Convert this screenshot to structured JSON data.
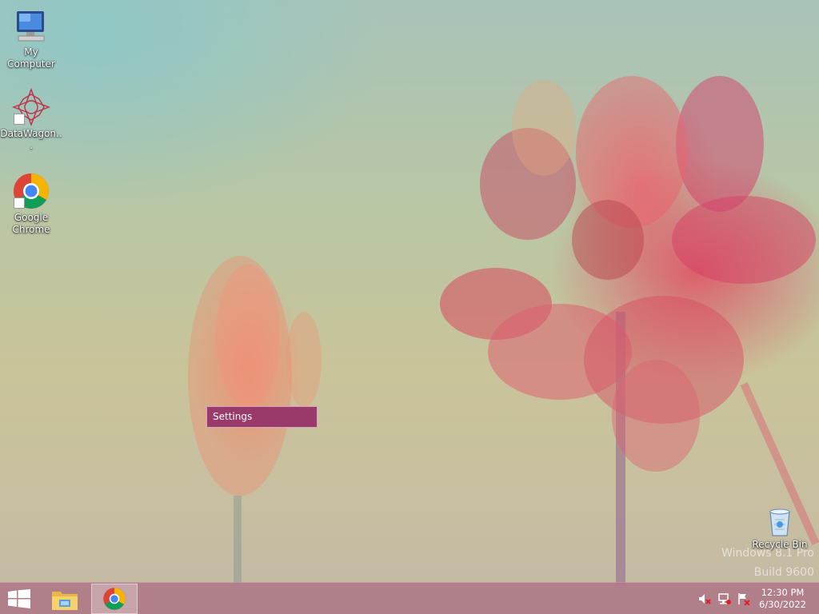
{
  "desktop": {
    "icons": [
      {
        "label": "My Computer",
        "icon": "computer-icon"
      },
      {
        "label": "DataWagon...",
        "icon": "datawagon-icon"
      },
      {
        "label": "Google Chrome",
        "icon": "chrome-icon"
      },
      {
        "label": "Recycle Bin",
        "icon": "recycle-bin-icon"
      }
    ],
    "context_menu": {
      "items": [
        "Settings"
      ]
    },
    "watermark": {
      "line1": "Windows 8.1 Pro",
      "line2": "Build 9600"
    }
  },
  "taskbar": {
    "start": {
      "icon": "windows-logo-icon"
    },
    "pinned": [
      {
        "name": "File Explorer",
        "icon": "file-explorer-icon"
      },
      {
        "name": "Google Chrome",
        "icon": "chrome-icon",
        "active": true
      }
    ],
    "tray": {
      "icons": [
        "volume-muted-icon",
        "network-disconnected-icon",
        "action-center-flag-icon"
      ],
      "time": "12:30 PM",
      "date": "6/30/2022"
    }
  },
  "colors": {
    "taskbar": "#aa6e82",
    "menu": "#9a3a6a",
    "menu_border": "#d5a6c0"
  }
}
